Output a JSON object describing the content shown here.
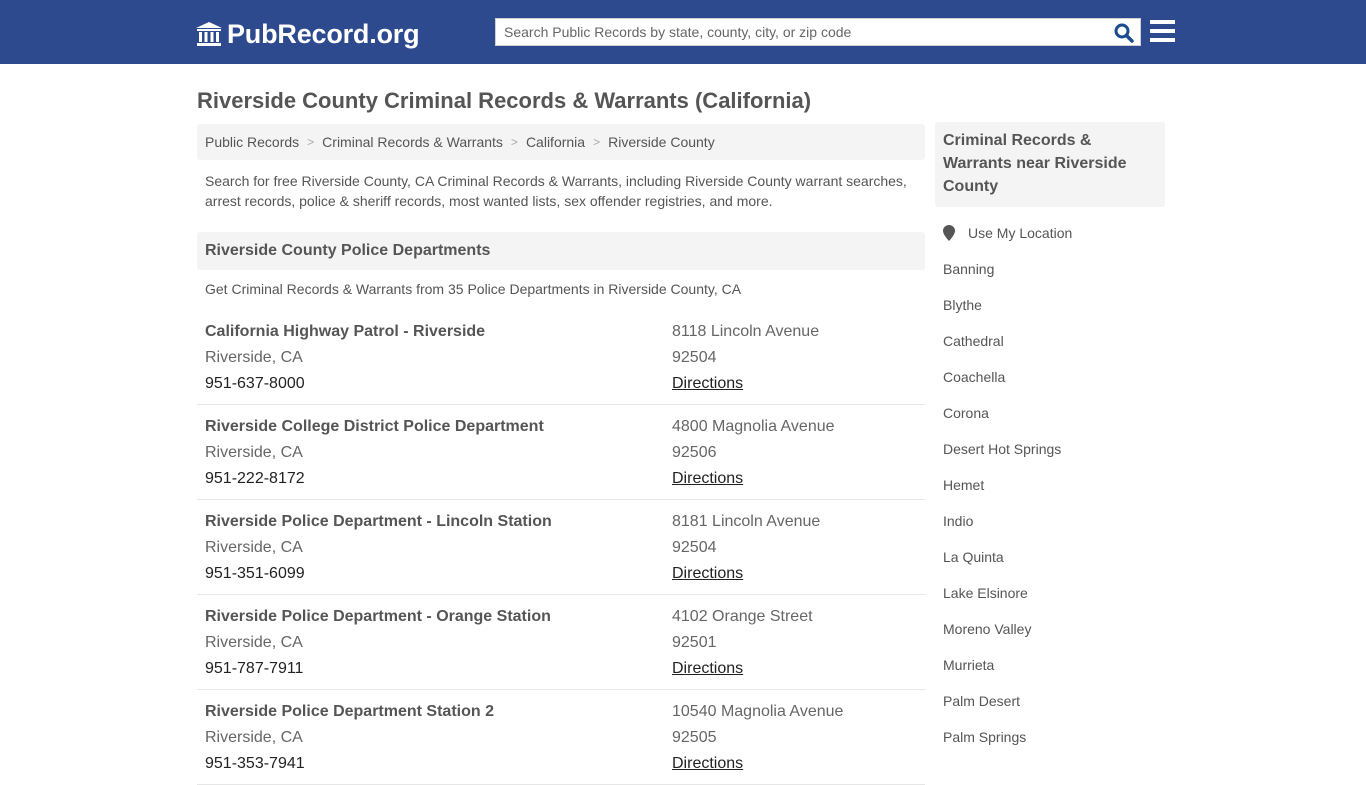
{
  "header": {
    "logo_text": "PubRecord.org",
    "search_placeholder": "Search Public Records by state, county, city, or zip code",
    "colors": {
      "brand": "#2d4a8f",
      "search_icon": "#1d4b8f"
    }
  },
  "page_title": "Riverside County Criminal Records & Warrants (California)",
  "breadcrumb": [
    "Public Records",
    "Criminal Records & Warrants",
    "California",
    "Riverside County"
  ],
  "breadcrumb_separator": ">",
  "intro": "Search for free Riverside County, CA Criminal Records & Warrants, including Riverside County warrant searches, arrest records, police & sheriff records, most wanted lists, sex offender registries, and more.",
  "section": {
    "title": "Riverside County Police Departments",
    "subtitle": "Get Criminal Records & Warrants from 35 Police Departments in Riverside County, CA"
  },
  "departments": [
    {
      "name": "California Highway Patrol - Riverside",
      "city": "Riverside, CA",
      "phone": "951-637-8000",
      "address": "8118 Lincoln Avenue",
      "zip": "92504",
      "link": "Directions"
    },
    {
      "name": "Riverside College District Police Department",
      "city": "Riverside, CA",
      "phone": "951-222-8172",
      "address": "4800 Magnolia Avenue",
      "zip": "92506",
      "link": "Directions"
    },
    {
      "name": "Riverside Police Department - Lincoln Station",
      "city": "Riverside, CA",
      "phone": "951-351-6099",
      "address": "8181 Lincoln Avenue",
      "zip": "92504",
      "link": "Directions"
    },
    {
      "name": "Riverside Police Department - Orange Station",
      "city": "Riverside, CA",
      "phone": "951-787-7911",
      "address": "4102 Orange Street",
      "zip": "92501",
      "link": "Directions"
    },
    {
      "name": "Riverside Police Department Station 2",
      "city": "Riverside, CA",
      "phone": "951-353-7941",
      "address": "10540 Magnolia Avenue",
      "zip": "92505",
      "link": "Directions"
    }
  ],
  "sidebar": {
    "title": "Criminal Records & Warrants near Riverside County",
    "use_location": "Use My Location",
    "cities": [
      "Banning",
      "Blythe",
      "Cathedral",
      "Coachella",
      "Corona",
      "Desert Hot Springs",
      "Hemet",
      "Indio",
      "La Quinta",
      "Lake Elsinore",
      "Moreno Valley",
      "Murrieta",
      "Palm Desert",
      "Palm Springs"
    ]
  }
}
